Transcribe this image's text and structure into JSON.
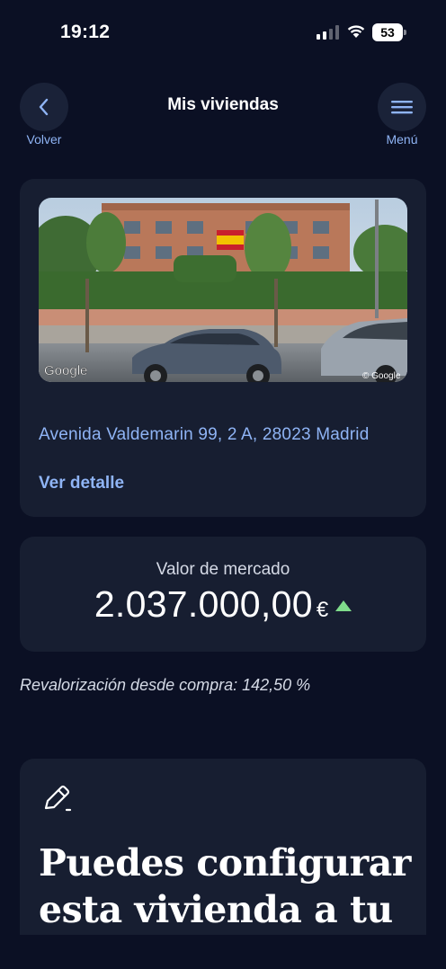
{
  "status_bar": {
    "time": "19:12",
    "battery": "53"
  },
  "header": {
    "title": "Mis viviendas",
    "back_label": "Volver",
    "menu_label": "Menú"
  },
  "property": {
    "photo_watermark_left": "Google",
    "photo_watermark_right": "© Google",
    "address": "Avenida Valdemarin 99, 2 A, 28023 Madrid",
    "detail_link": "Ver detalle"
  },
  "market_value": {
    "label": "Valor de mercado",
    "amount": "2.037.000,00",
    "currency": "€",
    "trend": "up",
    "trend_color": "#7fdc8b"
  },
  "revaluation": "Revalorización desde compra: 142,50 %",
  "config_card": {
    "icon": "pencil-icon",
    "title": "Puedes configurar esta vivienda a tu"
  },
  "colors": {
    "background": "#0b1024",
    "card": "#171e31",
    "accent": "#8fb4f5"
  }
}
